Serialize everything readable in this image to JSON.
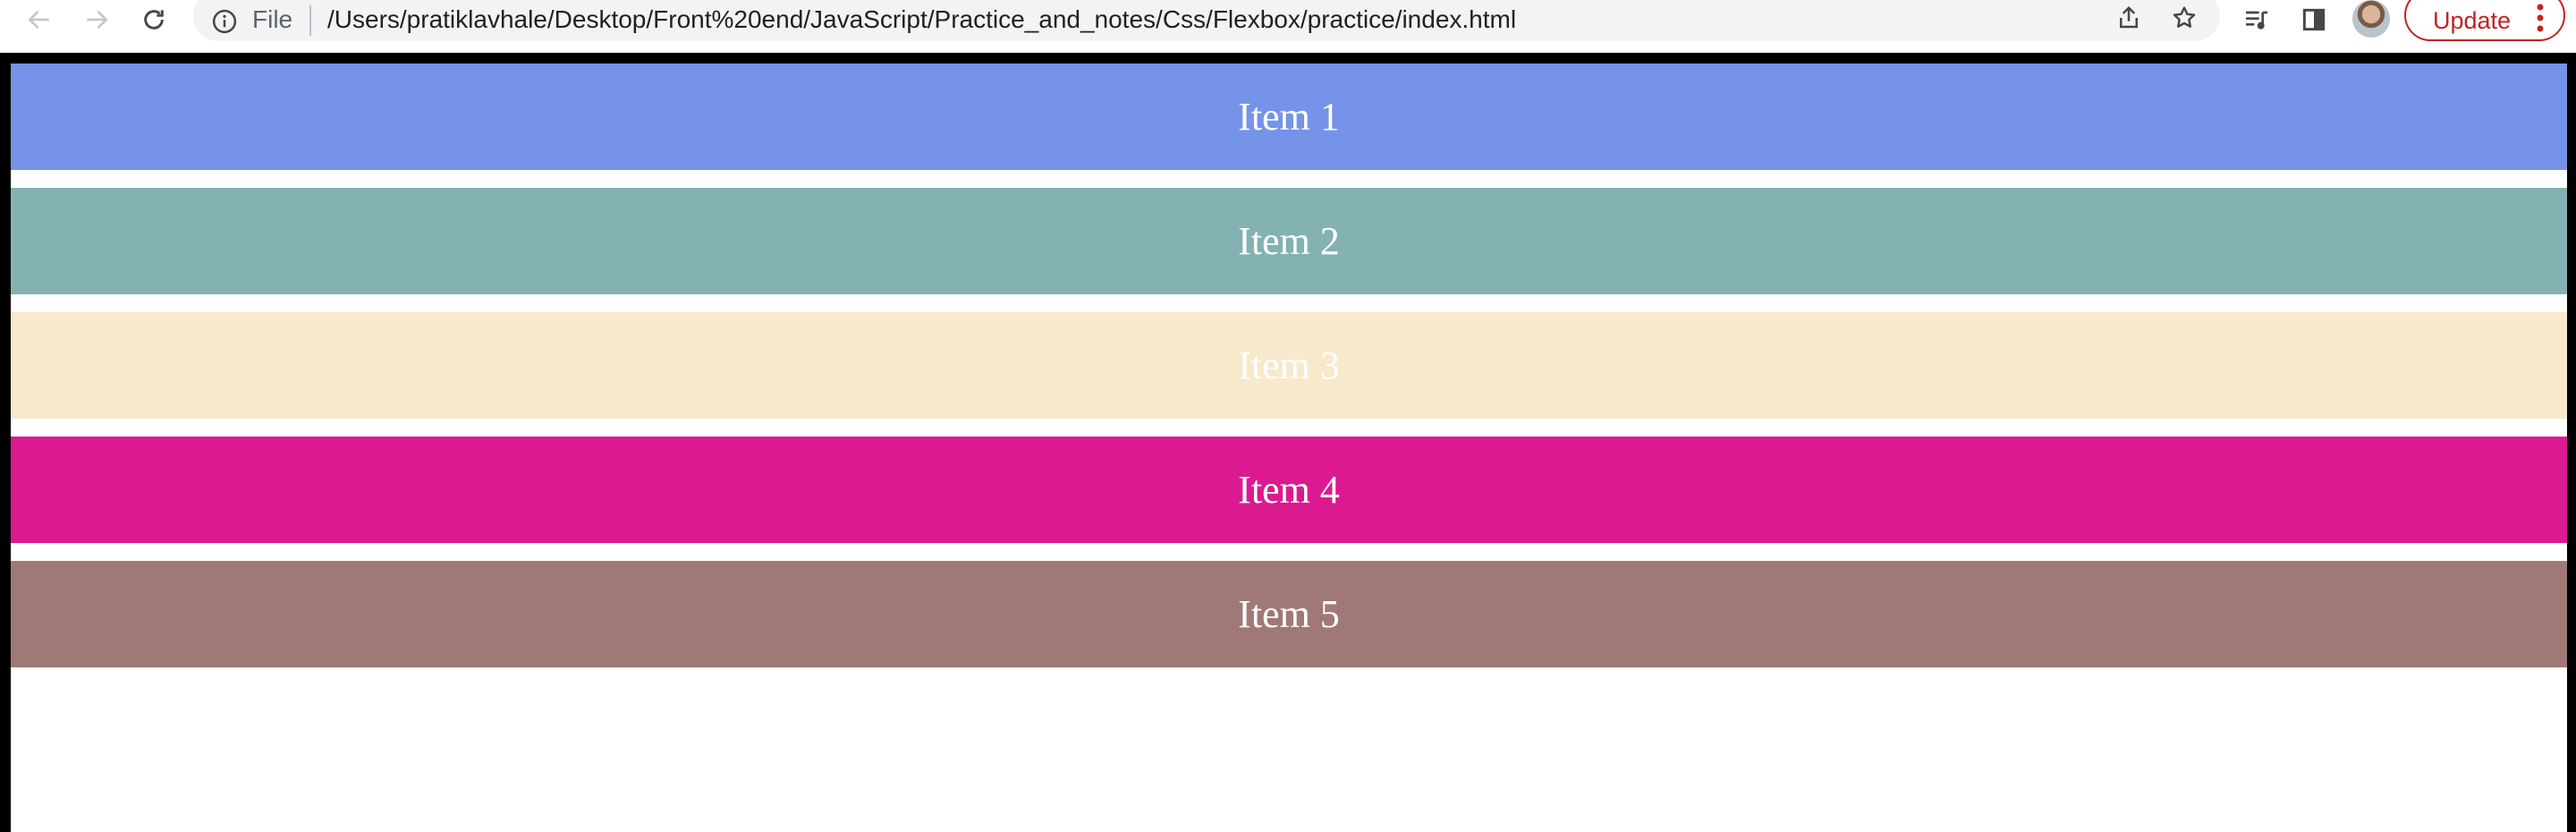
{
  "browser": {
    "omnibox": {
      "scheme_label": "File",
      "url": "/Users/pratiklavhale/Desktop/Front%20end/JavaScript/Practice_and_notes/Css/Flexbox/practice/index.html"
    },
    "update_label": "Update",
    "icons": [
      "back-arrow-icon",
      "forward-arrow-icon",
      "reload-icon",
      "info-icon",
      "share-icon",
      "star-icon",
      "reading-list-icon",
      "side-panel-icon",
      "kebab-menu-icon"
    ]
  },
  "page": {
    "items": [
      {
        "label": "Item 1",
        "color": "#7593e8"
      },
      {
        "label": "Item 2",
        "color": "#84b1b2"
      },
      {
        "label": "Item 3",
        "color": "#f8e9cd"
      },
      {
        "label": "Item 4",
        "color": "#db1a91"
      },
      {
        "label": "Item 5",
        "color": "#a07977"
      }
    ]
  }
}
